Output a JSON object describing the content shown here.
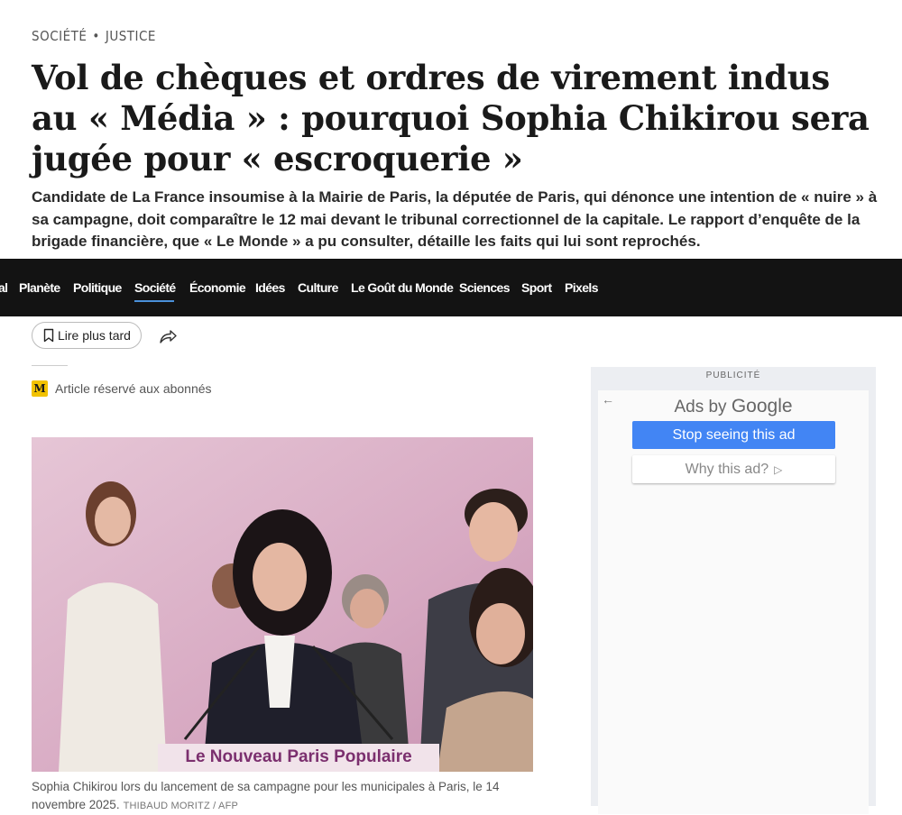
{
  "breadcrumb": {
    "section": "SOCIÉTÉ",
    "separator": "•",
    "subsection": "JUSTICE"
  },
  "article": {
    "title": "Vol de chèques et ordres de virement indus au « Média » : pourquoi Sophia Chikirou sera jugée pour « escroquerie »",
    "standfirst": "Candidate de La France insoumise à la Mairie de Paris, la députée de Paris, qui dénonce une intention de « nuire » à sa campagne, doit comparaître le 12 mai devant le tribunal correctionnel de la capitale. Le rapport d’enquête de la brigade financière, que « Le Monde » a pu consulter, détaille les faits qui lui sont reprochés."
  },
  "nav": {
    "items": [
      {
        "label": "al"
      },
      {
        "label": "Planète"
      },
      {
        "label": "Politique"
      },
      {
        "label": "Société",
        "active": true
      },
      {
        "label": "Économie"
      },
      {
        "label": "Idées"
      },
      {
        "label": "Culture"
      },
      {
        "label": "Le Goût du Monde"
      },
      {
        "label": "Sciences"
      },
      {
        "label": "Sport"
      },
      {
        "label": "Pixels"
      }
    ],
    "active_color": "#4a90d9",
    "background": "#131313"
  },
  "actions": {
    "save_label": "Lire plus tard",
    "save_icon": "bookmark-icon",
    "share_icon": "share-icon"
  },
  "subscriber": {
    "badge": "M",
    "label": "Article réservé aux abonnés",
    "badge_color": "#f2c200"
  },
  "photo": {
    "banner_text": "Le Nouveau Paris Populaire",
    "caption": "Sophia Chikirou lors du lancement de sa campagne pour les municipales à Paris, le 14 novembre 2025.",
    "credit": "THIBAUD MORITZ / AFP"
  },
  "ad": {
    "label": "PUBLICITÉ",
    "ads_by": "Ads by",
    "google": "Google",
    "stop_label": "Stop seeing this ad",
    "why_label": "Why this ad?",
    "back_icon": "arrow-left-icon",
    "stop_color": "#4285f4"
  }
}
